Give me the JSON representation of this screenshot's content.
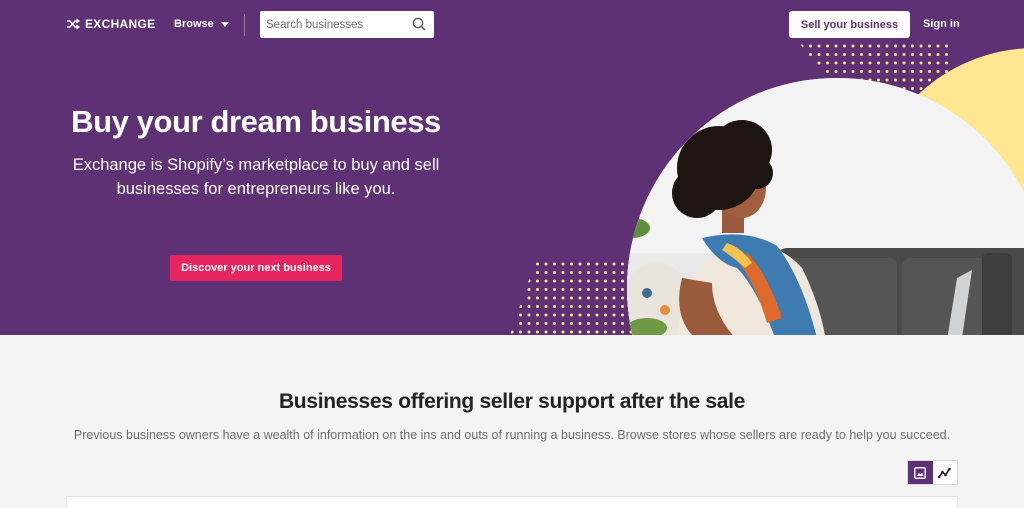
{
  "nav": {
    "logo_text": "EXCHANGE",
    "browse_label": "Browse",
    "search_placeholder": "Search businesses",
    "sell_label": "Sell your business",
    "signin_label": "Sign in"
  },
  "hero": {
    "title": "Buy your dream business",
    "subtitle": "Exchange is Shopify’s marketplace to buy and sell businesses for entrepreneurs like you.",
    "cta_label": "Discover your next business"
  },
  "section": {
    "title": "Businesses offering seller support after the sale",
    "description": "Previous business owners have a wealth of information on the ins and outs of running a business. Browse stores whose sellers are ready to help you succeed."
  },
  "view_toggle": {
    "options": [
      "grid-view",
      "chart-view"
    ],
    "selected": "grid-view"
  },
  "colors": {
    "brand_purple": "#5e3174",
    "cta_pink": "#e6245e",
    "accent_yellow": "#ffe690"
  }
}
